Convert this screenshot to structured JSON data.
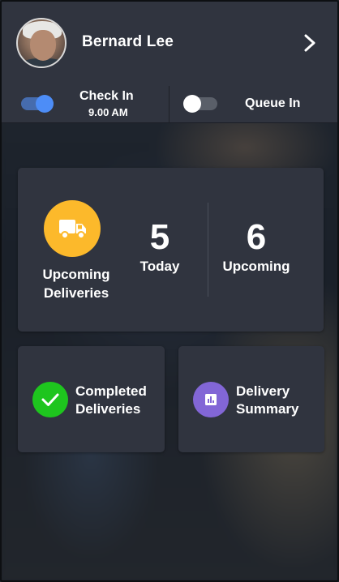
{
  "user": {
    "name": "Bernard Lee"
  },
  "status": {
    "check_in_label": "Check In",
    "check_in_time": "9.00 AM",
    "check_in_enabled": true,
    "queue_in_label": "Queue In",
    "queue_in_enabled": false
  },
  "summary_card": {
    "title_line1": "Upcoming",
    "title_line2": "Deliveries",
    "today_count": "5",
    "today_label": "Today",
    "upcoming_count": "6",
    "upcoming_label": "Upcoming",
    "icon": "truck-icon"
  },
  "actions": {
    "completed_line1": "Completed",
    "completed_line2": "Deliveries",
    "completed_icon": "checkmark-icon",
    "summary_line1": "Delivery",
    "summary_line2": "Summary",
    "summary_icon": "bar-chart-icon"
  },
  "colors": {
    "panel": "#30343f",
    "toggle_on": "#4d8df7",
    "truck_circle": "#fcb92b",
    "completed_circle": "#1ec51e",
    "summary_circle": "#8266d6"
  }
}
